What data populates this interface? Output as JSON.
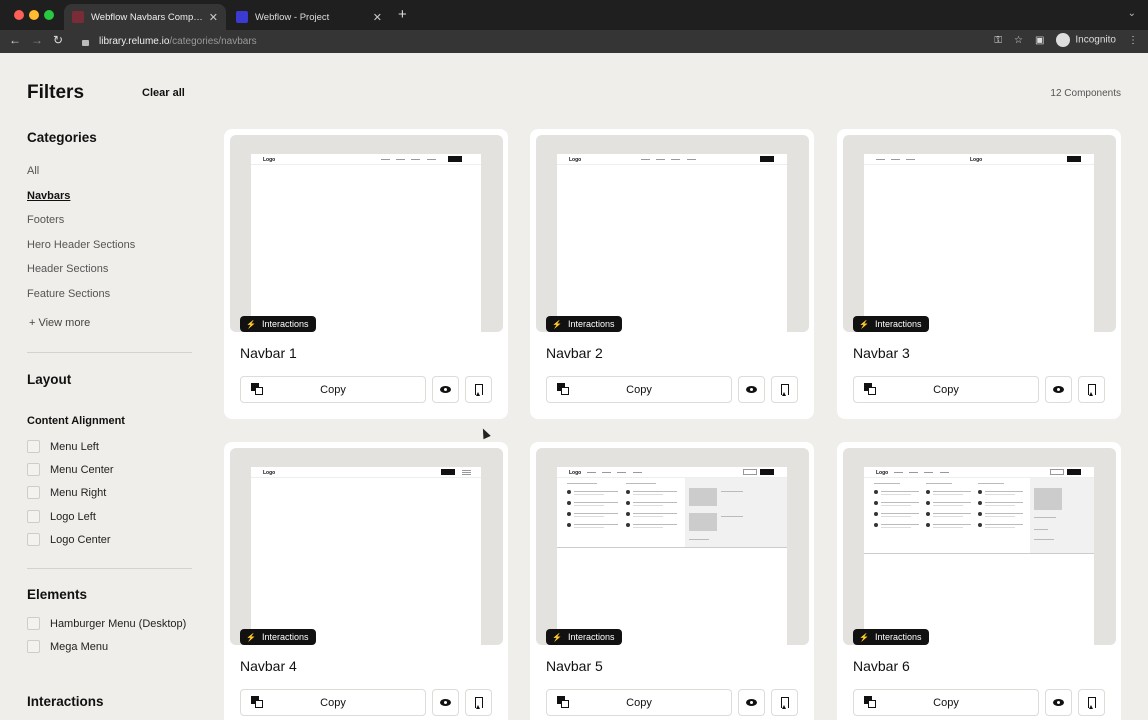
{
  "browser": {
    "tabs": [
      {
        "title": "Webflow Navbars Components",
        "active": true,
        "favicon_color": "#7a2c36"
      },
      {
        "title": "Webflow - Project",
        "active": false,
        "favicon_color": "#3b3bd1"
      }
    ],
    "url_host": "library.relume.io",
    "url_path": "/categories/navbars",
    "profile_label": "Incognito"
  },
  "sidebar": {
    "title": "Filters",
    "clear_all": "Clear all",
    "categories_title": "Categories",
    "categories": [
      {
        "label": "All",
        "active": false
      },
      {
        "label": "Navbars",
        "active": true
      },
      {
        "label": "Footers",
        "active": false
      },
      {
        "label": "Hero Header Sections",
        "active": false
      },
      {
        "label": "Header Sections",
        "active": false
      },
      {
        "label": "Feature Sections",
        "active": false
      }
    ],
    "view_more": "+ View more",
    "layout_title": "Layout",
    "content_alignment_title": "Content Alignment",
    "alignment_options": [
      "Menu Left",
      "Menu Center",
      "Menu Right",
      "Logo Left",
      "Logo Center"
    ],
    "elements_title": "Elements",
    "element_options": [
      "Hamburger Menu (Desktop)",
      "Mega Menu"
    ],
    "interactions_title": "Interactions"
  },
  "main": {
    "count": "12 Components",
    "cards": [
      {
        "name": "Navbar 1",
        "badge": "Interactions",
        "copy_label": "Copy",
        "mock_logo": "Logo"
      },
      {
        "name": "Navbar 2",
        "badge": "Interactions",
        "copy_label": "Copy",
        "mock_logo": "Logo"
      },
      {
        "name": "Navbar 3",
        "badge": "Interactions",
        "copy_label": "Copy",
        "mock_logo": "Logo"
      },
      {
        "name": "Navbar 4",
        "badge": "Interactions",
        "copy_label": "Copy",
        "mock_logo": "Logo"
      },
      {
        "name": "Navbar 5",
        "badge": "Interactions",
        "copy_label": "Copy",
        "mock_logo": "Logo"
      },
      {
        "name": "Navbar 6",
        "badge": "Interactions",
        "copy_label": "Copy",
        "mock_logo": "Logo"
      }
    ]
  },
  "colors": {
    "page_bg": "#efeeea",
    "card_bg": "#ffffff",
    "badge_bg": "#111111",
    "chrome_bg": "#1f1f1f"
  }
}
